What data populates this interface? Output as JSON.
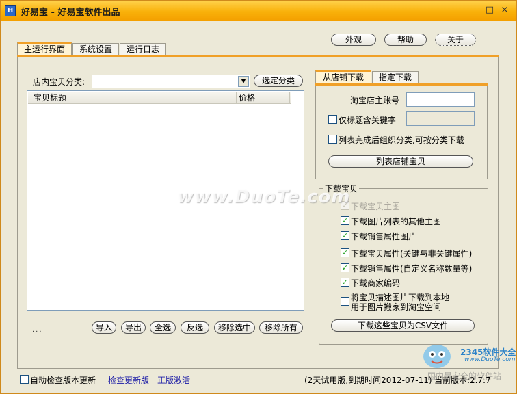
{
  "window": {
    "icon": "H",
    "title": "好易宝 - 好易宝软件出品",
    "controls": {
      "minimize": "_",
      "maximize": "□",
      "close": "×"
    }
  },
  "top_buttons": {
    "appearance": "外观",
    "help": "帮助",
    "about": "关于"
  },
  "tabs": [
    "主运行界面",
    "系统设置",
    "运行日志"
  ],
  "left": {
    "category_label": "店内宝贝分类:",
    "category_value": "",
    "select_category_button": "选定分类",
    "list_columns": [
      "宝贝标题",
      "价格"
    ],
    "dots": "...",
    "buttons": {
      "import": "导入",
      "export": "导出",
      "select_all": "全选",
      "invert": "反选",
      "remove_selected": "移除选中",
      "remove_all": "移除所有"
    }
  },
  "right_tabs": [
    "从店铺下载",
    "指定下载"
  ],
  "shop_download": {
    "account_label": "淘宝店主账号",
    "account_value": "",
    "keyword_checkbox": "仅标题含关键字",
    "keyword_value": "",
    "organize_checkbox": "列表完成后组织分类,可按分类下载",
    "list_button": "列表店铺宝贝"
  },
  "download_group": {
    "title": "下载宝贝",
    "options": [
      {
        "label": "下载宝贝主图",
        "checked": true,
        "disabled": true
      },
      {
        "label": "下载图片列表的其他主图",
        "checked": true,
        "disabled": false
      },
      {
        "label": "下载销售属性图片",
        "checked": true,
        "disabled": false
      },
      {
        "label": "下载宝贝属性(关键与非关键属性)",
        "checked": true,
        "disabled": false
      },
      {
        "label": "下载销售属性(自定义名称数量等)",
        "checked": true,
        "disabled": false
      },
      {
        "label": "下载商家编码",
        "checked": true,
        "disabled": false
      }
    ],
    "desc_option_line1": "将宝贝描述图片下载到本地",
    "desc_option_line2": "用于图片搬家到淘宝空间",
    "csv_button": "下载这些宝贝为CSV文件"
  },
  "watermark": "www.DuoTe.com",
  "footer": {
    "auto_check": "自动检查版本更新",
    "check_update": "检查更新版",
    "activate": "正版激活",
    "trial": "(2天试用版,到期时间2012-07-11)",
    "version": "当前版本:2.7.7"
  },
  "logo_watermark": {
    "brand": "2345软件大全",
    "url": "www.DuoTe.com",
    "slogan": "国内最安全的软件站"
  },
  "colors": {
    "accent": "#f0a028",
    "title_bar": "#f9b10a",
    "link": "#1a1aa6",
    "check": "#21a121"
  }
}
